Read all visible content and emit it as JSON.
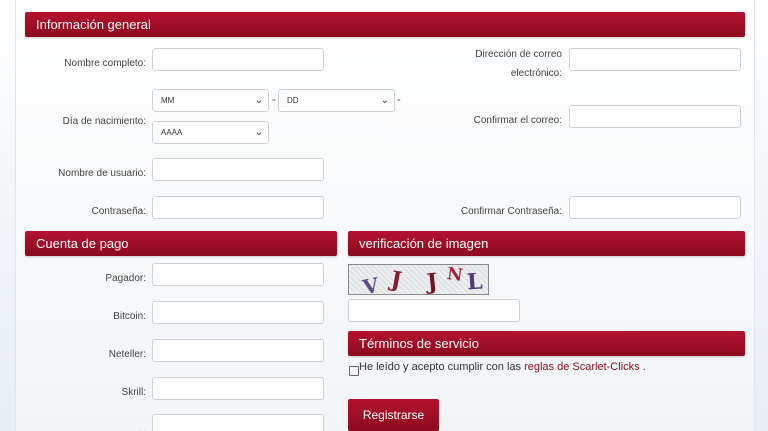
{
  "sections": {
    "general": "Información general",
    "payment": "Cuenta de pago",
    "captcha": "verificación de imagen",
    "terms": "Términos de servicio"
  },
  "general": {
    "full_name_label": "Nombre completo:",
    "email_label_line1": "Dirección de correo",
    "email_label_line2": "electrónico:",
    "birth_label": "Día de nacimiento:",
    "confirm_email_label": "Confirmar el correo:",
    "username_label": "Nombre de usuario:",
    "password_label": "Contraseña:",
    "confirm_password_label": "Confirmar Contraseña:",
    "month_select": "MM",
    "day_select": "DD",
    "year_select": "AAAA",
    "separator": "-"
  },
  "payment": {
    "payer_label": "Pagador:",
    "bitcoin_label": "Bitcoin:",
    "neteller_label": "Neteller:",
    "skrill_label": "Skrill:",
    "partial_label": "..."
  },
  "captcha": {
    "glyphs": [
      "V",
      "J",
      "J",
      "N",
      "L"
    ]
  },
  "terms": {
    "text_before": "He leído y acepto cumplir con las ",
    "link_text": "reglas de Scarlet-Clicks",
    "text_after": " ."
  },
  "submit_label": "Registrarse",
  "colors": {
    "accent": "#9e0f27",
    "link": "#8c0b1f"
  }
}
